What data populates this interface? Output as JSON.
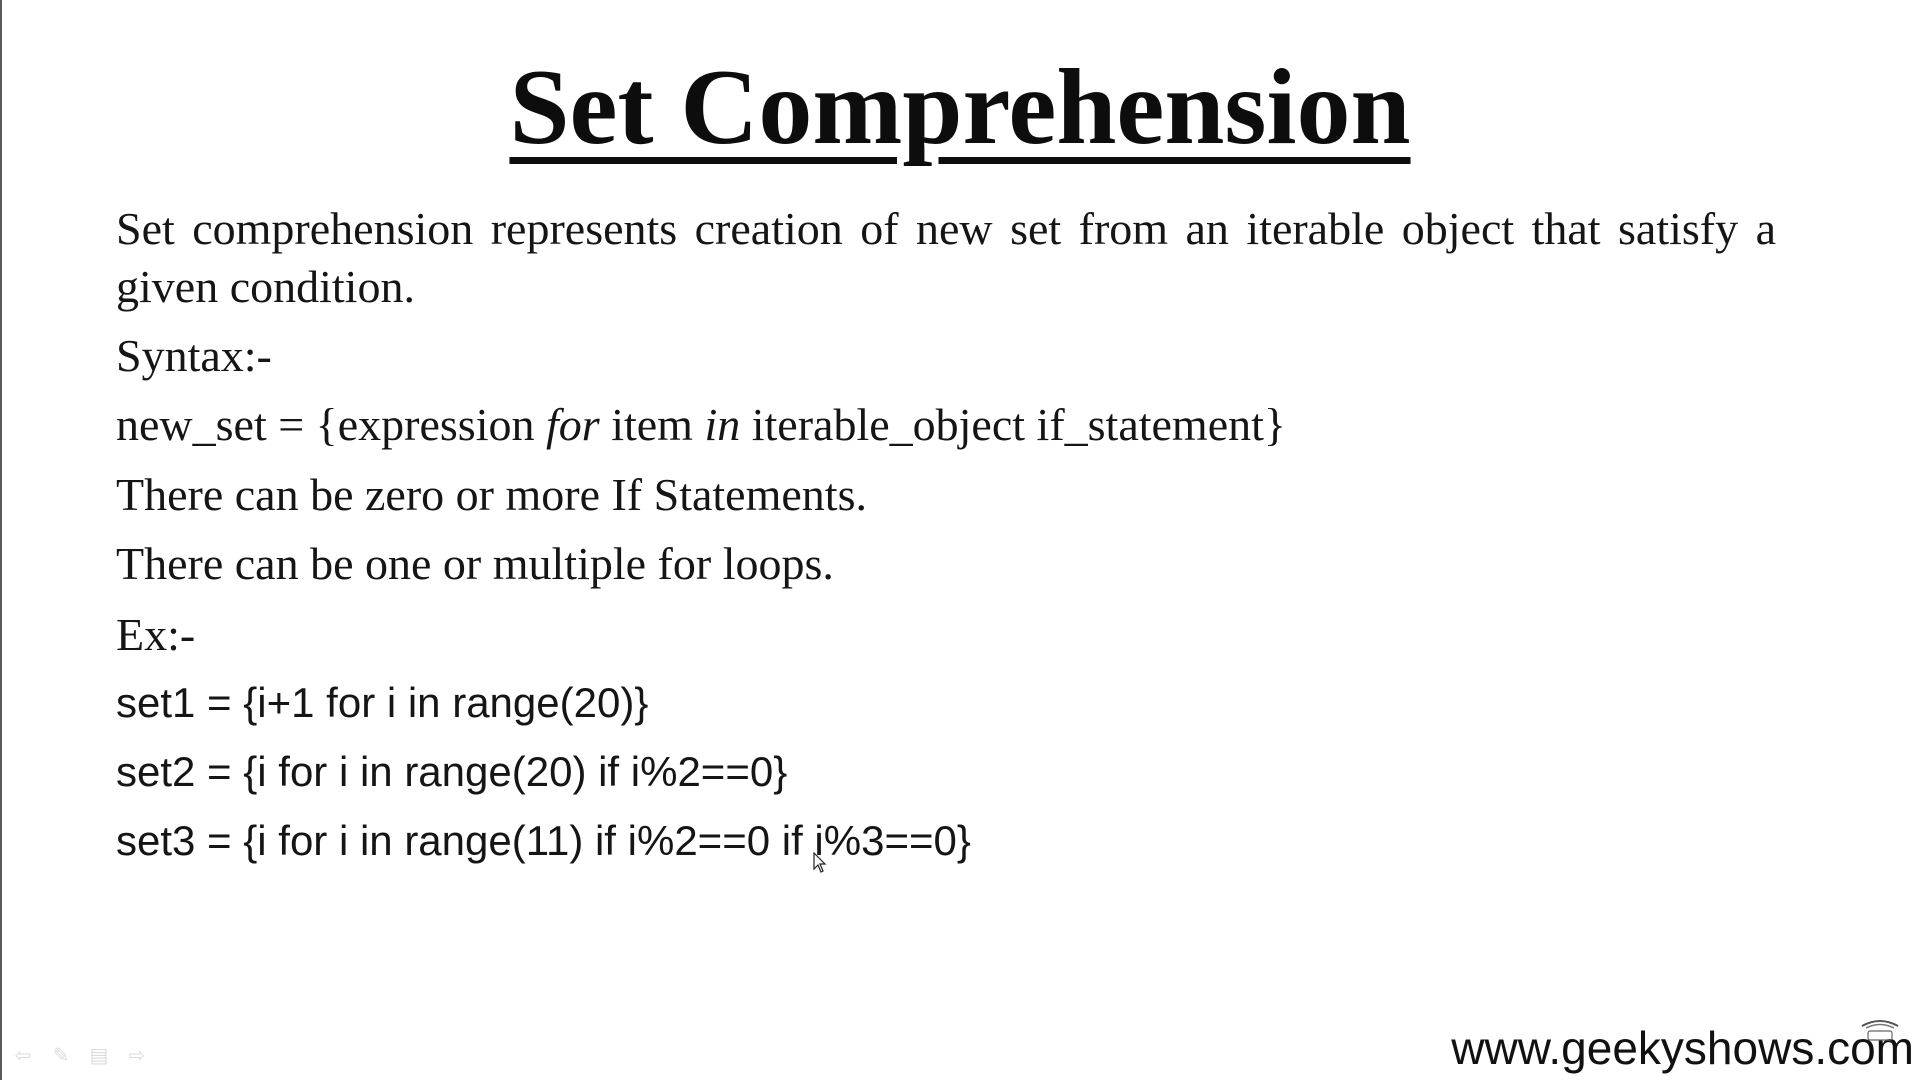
{
  "slide": {
    "title": "Set Comprehension",
    "description": "Set comprehension represents creation of new set from an iterable object that satisfy a given condition.",
    "syntax_label": "Syntax:-",
    "syntax": {
      "part1": "new_set = {expression ",
      "kw_for": "for",
      "part2": " item ",
      "kw_in": "in",
      "part3": " iterable_object if_statement}"
    },
    "note_if": "There can be zero or more If Statements.",
    "note_for": "There can be one or multiple for loops.",
    "example_label": "Ex:-",
    "examples": [
      "set1 = {i+1 for i in range(20)}",
      "set2 = {i for i in range(20) if i%2==0}",
      "set3 = {i for i in range(11) if i%2==0 if i%3==0}"
    ]
  },
  "footer": {
    "website": "www.geekyshows.com"
  },
  "player_controls": {
    "icons": [
      "previous-icon",
      "pen-icon",
      "menu-icon",
      "next-icon"
    ]
  }
}
